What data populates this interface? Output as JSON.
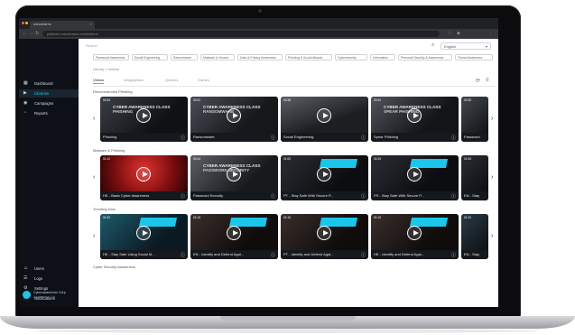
{
  "browser": {
    "tab_title": "nanolearnx",
    "url": "platform.nanolearnx.com/videos"
  },
  "sidebar": {
    "items": [
      {
        "label": "Dashboard",
        "icon": "grid-icon"
      },
      {
        "label": "Libraries",
        "icon": "play-library-icon"
      },
      {
        "label": "Campaigns",
        "icon": "megaphone-icon"
      },
      {
        "label": "Reports",
        "icon": "chart-icon"
      }
    ],
    "bottom_items": [
      {
        "label": "Users",
        "icon": "users-icon"
      },
      {
        "label": "Logs",
        "icon": "logs-icon"
      },
      {
        "label": "Settings",
        "icon": "gear-icon"
      },
      {
        "label": "Notifications",
        "icon": "bell-icon"
      }
    ],
    "user": {
      "name": "Cyberawareness Corp",
      "company": "Awareness Ltd."
    }
  },
  "toolbar": {
    "search_placeholder": "Search",
    "language": "English"
  },
  "chips": [
    "Password Awareness",
    "Social Engineering",
    "Ransomware",
    "Malware & Viruses",
    "Data & Privacy Awareness",
    "Phishing & Social Attacks",
    "Cybersecurity",
    "Information",
    "Personal Security & Awareness",
    "Threat Awareness"
  ],
  "breadcrumb": "Library  >  Videos",
  "view_tabs": [
    "Videos",
    "Infographics",
    "Quizzes",
    "Games"
  ],
  "sections": [
    {
      "title": "Recommended Phishing",
      "cards": [
        {
          "caption": "Phishing",
          "duration": "00:36",
          "overlay": "CYBER AWARENESS CLASS\nPHISHING",
          "theme": "dark",
          "banner": false
        },
        {
          "caption": "Ransomware",
          "duration": "00:42",
          "overlay": "CYBER AWARENESS CLASS\nRANSOMWARE",
          "theme": "dark",
          "banner": false
        },
        {
          "caption": "Social Engineering",
          "duration": "00:38",
          "overlay": "",
          "theme": "dark",
          "banner": false
        },
        {
          "caption": "Spear Phishing",
          "duration": "00:40",
          "overlay": "CYBER AWARENESS CLASS\nSPEAR PHISHING",
          "theme": "dark",
          "banner": false
        },
        {
          "caption": "Password",
          "duration": "00:35",
          "overlay": "",
          "theme": "dark",
          "banner": false
        }
      ]
    },
    {
      "title": "Malware & Phishing",
      "cards": [
        {
          "caption": "HE - Basic Cyber Awareness",
          "duration": "01:12",
          "overlay": "",
          "theme": "red",
          "banner": false
        },
        {
          "caption": "Password Security",
          "duration": "00:44",
          "overlay": "CYBER AWARENESS CLASS\nPASSWORD SECURITY",
          "theme": "dark",
          "banner": false
        },
        {
          "caption": "PT - Stay Safe With Secure P...",
          "duration": "01:05",
          "overlay": "",
          "theme": "dark",
          "banner": true
        },
        {
          "caption": "FR - Stay Safe With Secure P...",
          "duration": "01:05",
          "overlay": "",
          "theme": "dark",
          "banner": true
        },
        {
          "caption": "EN - Stay",
          "duration": "01:05",
          "overlay": "",
          "theme": "dark",
          "banner": true
        }
      ]
    },
    {
      "title": "Trending Now",
      "cards": [
        {
          "caption": "HE - Stay Safe Using Social M...",
          "duration": "01:20",
          "overlay": "",
          "theme": "dark",
          "banner": true
        },
        {
          "caption": "EN - Identify and Defend Agai...",
          "duration": "01:15",
          "overlay": "",
          "theme": "dark",
          "banner": true
        },
        {
          "caption": "PT - Identify and Defend Agai...",
          "duration": "01:15",
          "overlay": "",
          "theme": "dark",
          "banner": true
        },
        {
          "caption": "HE - Identify and Defend Agai...",
          "duration": "01:15",
          "overlay": "",
          "theme": "dark",
          "banner": true
        },
        {
          "caption": "EN - Stay",
          "duration": "01:10",
          "overlay": "",
          "theme": "dark",
          "banner": true
        }
      ]
    },
    {
      "title": "Cyber Security Awareness",
      "cards": []
    }
  ],
  "colors": {
    "accent": "#22c3e6",
    "sidebar": "#0d1117",
    "banner": "#1cc6ea"
  }
}
